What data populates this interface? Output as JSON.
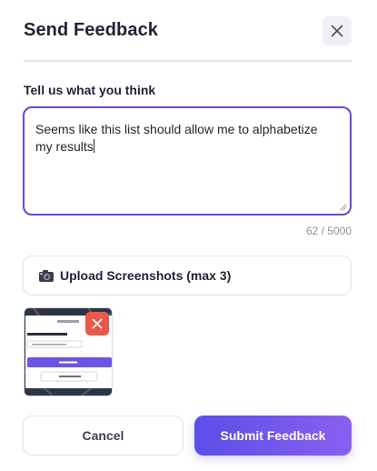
{
  "dialog": {
    "title": "Send Feedback",
    "close_icon": "close-icon"
  },
  "feedback": {
    "label": "Tell us what you think",
    "value": "Seems like this list should allow me to alphabetize my results",
    "char_count": "62 / 5000"
  },
  "upload": {
    "icon": "camera-icon",
    "label": "Upload Screenshots (max 3)"
  },
  "attachments": [
    {
      "thumbnail": "screenshot-thumbnail",
      "remove_icon": "close-icon",
      "remove_color": "#e8594c"
    }
  ],
  "actions": {
    "cancel_label": "Cancel",
    "submit_label": "Submit Feedback"
  },
  "colors": {
    "accent": "#5a52d8",
    "submit_gradient_start": "#5b4ee8",
    "submit_gradient_end": "#8a5ff0",
    "remove_red": "#e8594c",
    "border": "#dfe2e8"
  }
}
